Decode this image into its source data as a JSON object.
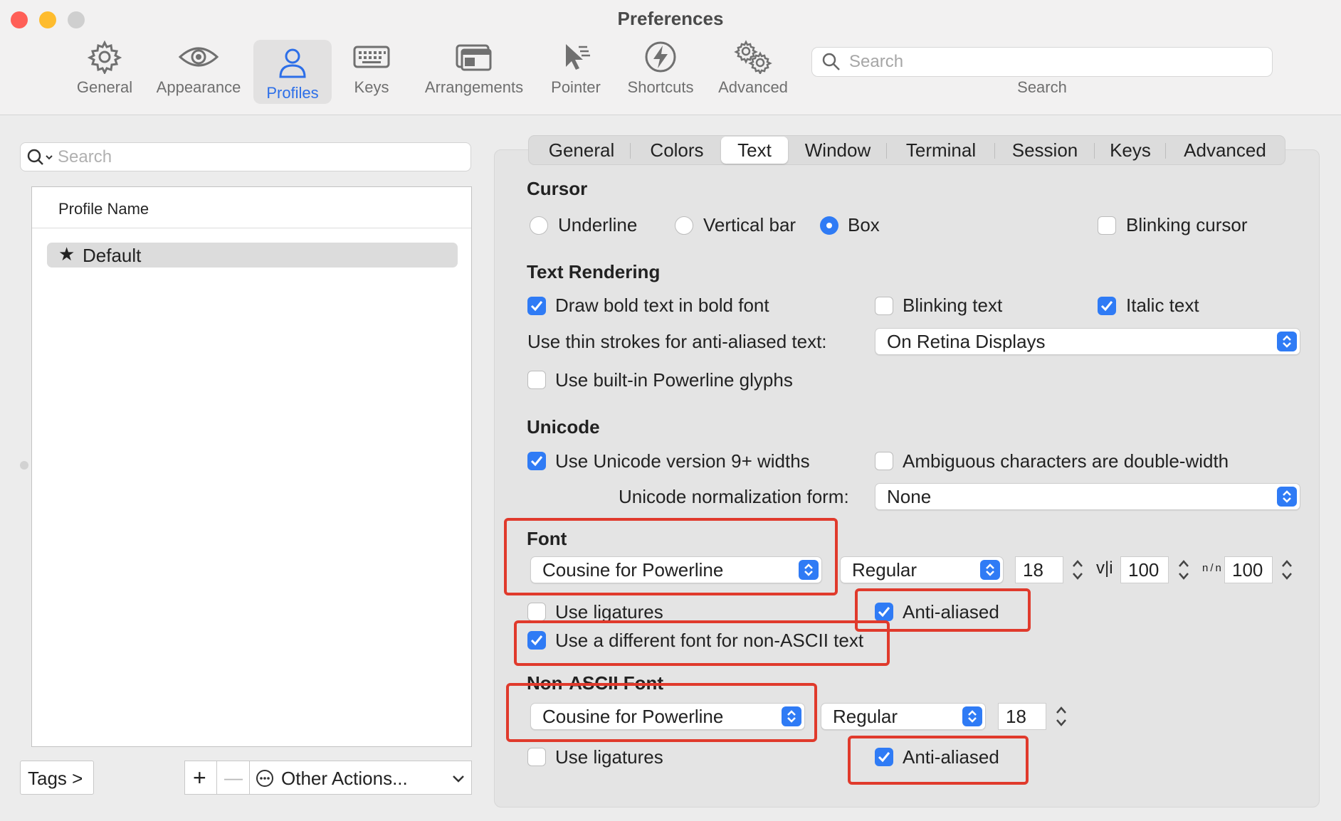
{
  "window": {
    "title": "Preferences",
    "traffic_colors": [
      "#ff5f57",
      "#febc2e",
      "#cfcfcf"
    ]
  },
  "toolbar": {
    "items": [
      {
        "label": "General",
        "icon": "gear-icon"
      },
      {
        "label": "Appearance",
        "icon": "eye-icon"
      },
      {
        "label": "Profiles",
        "icon": "person-icon",
        "selected": true
      },
      {
        "label": "Keys",
        "icon": "keyboard-icon"
      },
      {
        "label": "Arrangements",
        "icon": "windows-icon"
      },
      {
        "label": "Pointer",
        "icon": "pointer-icon"
      },
      {
        "label": "Shortcuts",
        "icon": "bolt-icon"
      },
      {
        "label": "Advanced",
        "icon": "gears-icon"
      }
    ],
    "search": {
      "placeholder": "Search",
      "caption": "Search"
    }
  },
  "profiles": {
    "search_placeholder": "Search",
    "column_header": "Profile Name",
    "rows": [
      {
        "name": "Default",
        "starred": true
      }
    ],
    "tags_button": "Tags >",
    "add_button": "+",
    "remove_button": "—",
    "other_actions": "Other Actions..."
  },
  "tabs": {
    "items": [
      "General",
      "Colors",
      "Text",
      "Window",
      "Terminal",
      "Session",
      "Keys",
      "Advanced"
    ],
    "selected": "Text"
  },
  "cursor": {
    "title": "Cursor",
    "options": [
      "Underline",
      "Vertical bar",
      "Box"
    ],
    "selected": "Box",
    "blinking_label": "Blinking cursor",
    "blinking": false
  },
  "text_rendering": {
    "title": "Text Rendering",
    "bold_label": "Draw bold text in bold font",
    "bold": true,
    "blinking_label": "Blinking text",
    "blinking": false,
    "italic_label": "Italic text",
    "italic": true,
    "thin_strokes_label": "Use thin strokes for anti-aliased text:",
    "thin_strokes_value": "On Retina Displays",
    "powerline_label": "Use built-in Powerline glyphs",
    "powerline": false
  },
  "unicode": {
    "title": "Unicode",
    "widths_label": "Use Unicode version 9+ widths",
    "widths": true,
    "ambiguous_label": "Ambiguous characters are double-width",
    "ambiguous": false,
    "normalization_label": "Unicode normalization form:",
    "normalization_value": "None"
  },
  "font": {
    "title": "Font",
    "family": "Cousine for Powerline",
    "weight": "Regular",
    "size": "18",
    "v_spacing_label": "v|i",
    "v_spacing": "100",
    "h_spacing_label": "n/n",
    "h_spacing": "100",
    "ligatures_label": "Use ligatures",
    "ligatures": false,
    "antialiased_label": "Anti-aliased",
    "antialiased": true,
    "non_ascii_toggle_label": "Use a different font for non-ASCII text",
    "non_ascii_toggle": true
  },
  "non_ascii_font": {
    "title": "Non-ASCII Font",
    "family": "Cousine for Powerline",
    "weight": "Regular",
    "size": "18",
    "ligatures_label": "Use ligatures",
    "ligatures": false,
    "antialiased_label": "Anti-aliased",
    "antialiased": true
  },
  "colors": {
    "accent": "#2f7bf5",
    "highlight": "#e03a2c"
  }
}
